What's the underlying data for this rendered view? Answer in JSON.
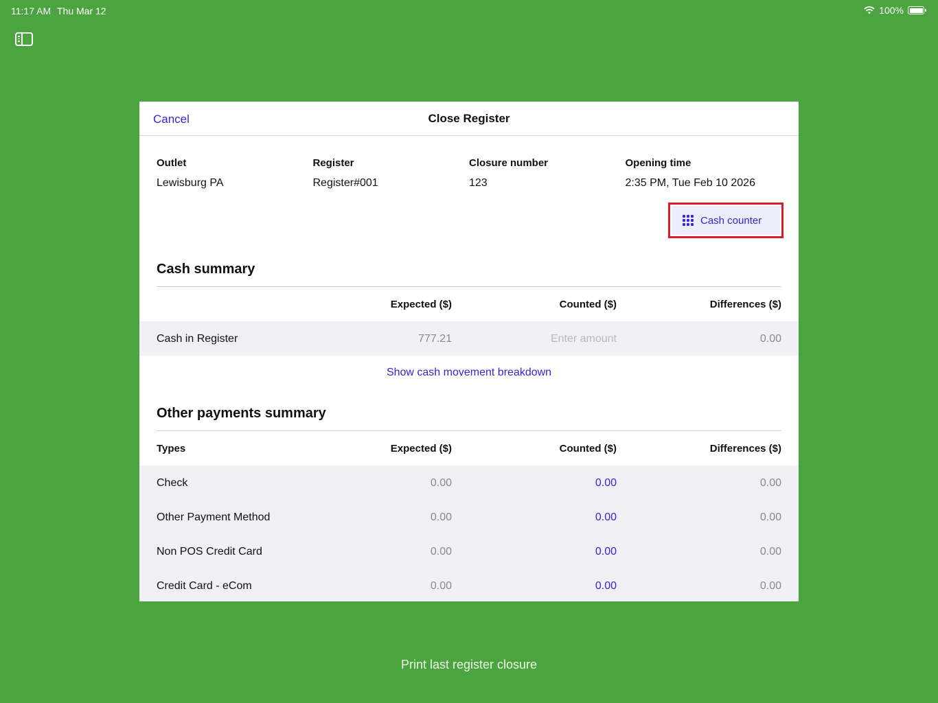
{
  "status_bar": {
    "time": "11:17 AM",
    "date": "Thu Mar 12",
    "battery": "100%"
  },
  "modal": {
    "cancel_label": "Cancel",
    "title": "Close Register"
  },
  "info": {
    "outlet_label": "Outlet",
    "outlet_value": "Lewisburg PA",
    "register_label": "Register",
    "register_value": "Register#001",
    "closure_label": "Closure number",
    "closure_value": "123",
    "opening_label": "Opening time",
    "opening_value": "2:35 PM, Tue Feb 10 2026"
  },
  "cash_counter_label": "Cash counter",
  "cash_summary": {
    "title": "Cash summary",
    "headers": {
      "expected": "Expected ($)",
      "counted": "Counted ($)",
      "differences": "Differences ($)"
    },
    "row": {
      "label": "Cash in Register",
      "expected": "777.21",
      "counted_placeholder": "Enter amount",
      "difference": "0.00"
    },
    "breakdown_link": "Show cash movement breakdown"
  },
  "other_payments": {
    "title": "Other payments summary",
    "headers": {
      "types": "Types",
      "expected": "Expected ($)",
      "counted": "Counted ($)",
      "differences": "Differences ($)"
    },
    "rows": [
      {
        "label": "Check",
        "expected": "0.00",
        "counted": "0.00",
        "difference": "0.00"
      },
      {
        "label": "Other Payment Method",
        "expected": "0.00",
        "counted": "0.00",
        "difference": "0.00"
      },
      {
        "label": "Non POS Credit Card",
        "expected": "0.00",
        "counted": "0.00",
        "difference": "0.00"
      },
      {
        "label": "Credit Card - eCom",
        "expected": "0.00",
        "counted": "0.00",
        "difference": "0.00"
      }
    ]
  },
  "print_last_closure": "Print last register closure",
  "colors": {
    "background": "#4ba43f",
    "accent": "#3a22d6",
    "highlight_border": "#d81c2a"
  }
}
